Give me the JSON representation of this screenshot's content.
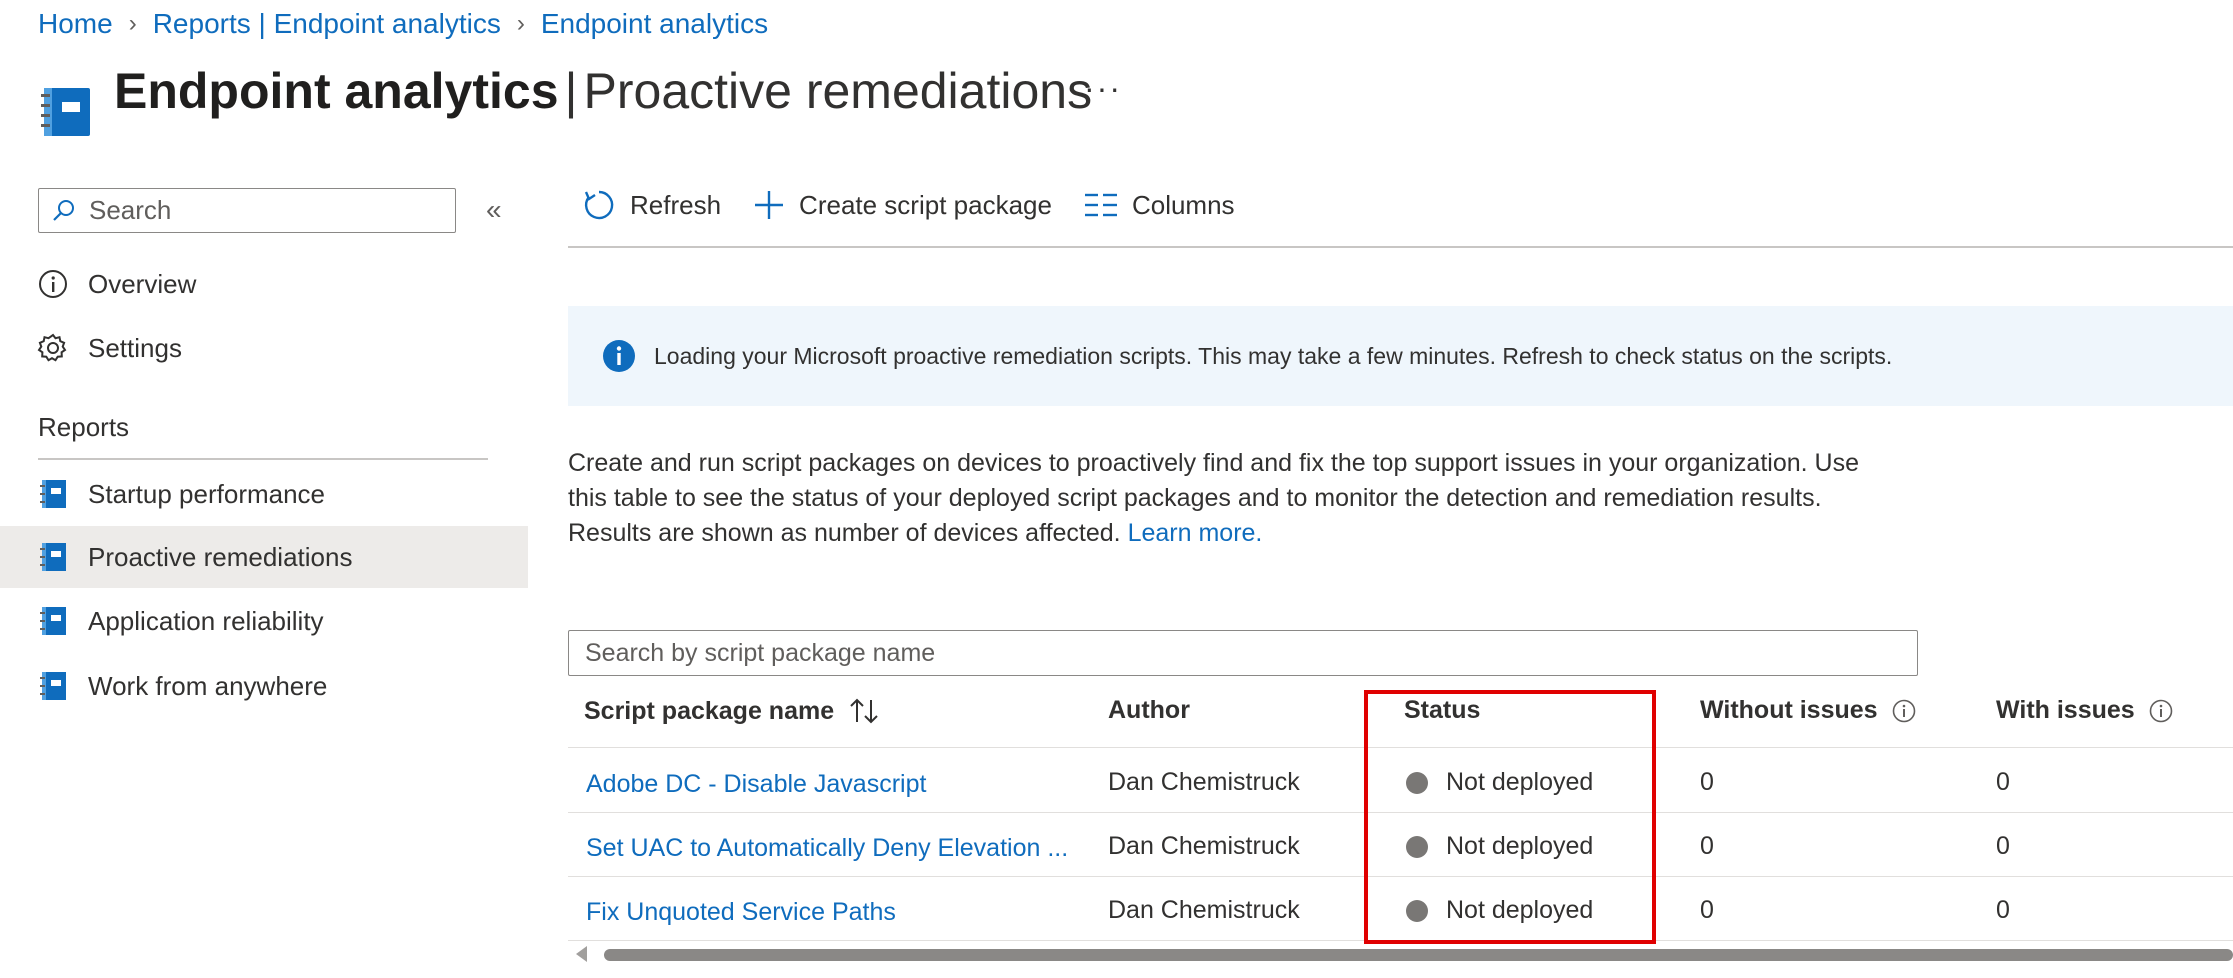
{
  "breadcrumb": [
    {
      "label": "Home"
    },
    {
      "label": "Reports | Endpoint analytics"
    },
    {
      "label": "Endpoint analytics"
    }
  ],
  "header": {
    "title_bold": "Endpoint analytics",
    "separator": "|",
    "title_rest": "Proactive remediations",
    "more": "···",
    "icon": "notebook-icon"
  },
  "sidebar": {
    "search_placeholder": "Search",
    "collapse": "«",
    "items": [
      {
        "label": "Overview",
        "icon": "info-circle-icon"
      },
      {
        "label": "Settings",
        "icon": "gear-icon"
      }
    ],
    "reports_heading": "Reports",
    "reports": [
      {
        "label": "Startup performance",
        "icon": "notebook-icon"
      },
      {
        "label": "Proactive remediations",
        "icon": "notebook-icon",
        "selected": true
      },
      {
        "label": "Application reliability",
        "icon": "notebook-icon"
      },
      {
        "label": "Work from anywhere",
        "icon": "notebook-icon"
      }
    ]
  },
  "toolbar": {
    "refresh": "Refresh",
    "create": "Create script package",
    "columns": "Columns"
  },
  "banner": {
    "text": "Loading your Microsoft proactive remediation scripts. This may take a few minutes. Refresh to check status on the scripts."
  },
  "description": {
    "line1": "Create and run script packages on devices to proactively find and fix the top support issues in your organization. Use",
    "line2": "this table to see the status of your deployed script packages and to monitor the detection and remediation results.",
    "line3": "Results are shown as number of devices affected.",
    "learn_more": "Learn more."
  },
  "table": {
    "search_placeholder": "Search by script package name",
    "columns": {
      "name": "Script package name",
      "author": "Author",
      "status": "Status",
      "without_issues": "Without issues",
      "with_issues": "With issues"
    },
    "rows": [
      {
        "name": "Adobe DC - Disable Javascript",
        "author": "Dan Chemistruck",
        "status": "Not deployed",
        "without_issues": "0",
        "with_issues": "0"
      },
      {
        "name": "Set UAC to Automatically Deny Elevation ...",
        "author": "Dan Chemistruck",
        "status": "Not deployed",
        "without_issues": "0",
        "with_issues": "0"
      },
      {
        "name": "Fix Unquoted Service Paths",
        "author": "Dan Chemistruck",
        "status": "Not deployed",
        "without_issues": "0",
        "with_issues": "0"
      }
    ]
  },
  "colors": {
    "accent": "#0f6cbd",
    "banner_bg": "#eff6fc",
    "selected_bg": "#edebe9",
    "highlight": "#e00000",
    "status_dot": "#797775"
  }
}
